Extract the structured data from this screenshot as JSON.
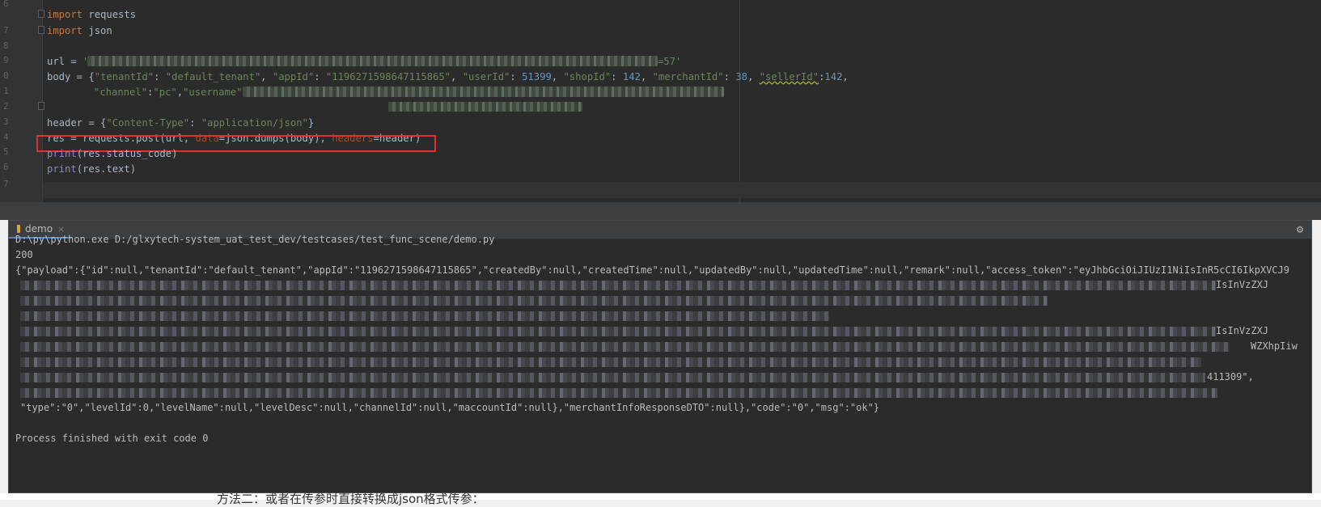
{
  "editor": {
    "line_numbers": [
      "6",
      "7",
      "8",
      "9",
      "0",
      "1",
      "2",
      "3",
      "4",
      "5",
      "6",
      "7"
    ],
    "lines": {
      "l6": {
        "kw": "import",
        "rest": " requests"
      },
      "l7": {
        "kw": "import",
        "rest": " json"
      },
      "l9": {
        "prefix": "url = ",
        "quote_open": "'",
        "visible_tail": "=57'"
      },
      "l10": {
        "a": "body = {",
        "k1": "\"tenantId\"",
        "s1": ": ",
        "v1": "\"default_tenant\"",
        "c1": ", ",
        "k2": "\"appId\"",
        "s2": ": ",
        "v2": "\"1196271598647115865\"",
        "c2": ", ",
        "k3": "\"userId\"",
        "s3": ": ",
        "v3": "51399",
        "c3": ", ",
        "k4": "\"shopId\"",
        "s4": ": ",
        "v4": "142",
        "c4": ", ",
        "k5": "\"merchantId\"",
        "s5": ": ",
        "v5": "38",
        "c5": ", ",
        "k6": "\"sellerId\"",
        "s6": ":",
        "v6": "142",
        "c6": ","
      },
      "l11": {
        "k1": "\"channel\"",
        "s1": ":",
        "v1": "\"pc\"",
        "c1": ",",
        "k2": "\"username\""
      },
      "l13": {
        "a": "header = {",
        "k": "\"Content-Type\"",
        "s": ": ",
        "v": "\"application/json\"",
        "b": "}"
      },
      "l14": {
        "a": "res = requests.post(url, ",
        "p1": "data",
        "b": "=json.dumps(body), ",
        "p2": "headers",
        "c": "=header)"
      },
      "l15": {
        "fn": "print",
        "rest": "(res.status_code)"
      },
      "l16": {
        "fn": "print",
        "rest": "(res.text)"
      }
    }
  },
  "run_panel": {
    "tab_label": "demo",
    "tab_close": "×",
    "gear": "⚙",
    "command": "D:\\py\\python.exe D:/glxytech-system_uat_test_dev/testcases/test_func_scene/demo.py",
    "status_code": "200",
    "payload_start": "{\"payload\":{\"id\":null,\"tenantId\":\"default_tenant\",\"appId\":\"1196271598647115865\",\"createdBy\":null,\"createdTime\":null,\"updatedBy\":null,\"updatedTime\":null,\"remark\":null,\"access_token\":\"eyJhbGciOiJIUzI1NiIsInR5cCI6IkpXVCJ9",
    "tail_1": "IsInVzZXJ",
    "tail_2": "IsInVzZXJ",
    "tail_3": "WZXhpIiw",
    "tail_4": "411309\",",
    "payload_end": "\"type\":\"0\",\"levelId\":0,\"levelName\":null,\"levelDesc\":null,\"channelId\":null,\"maccountId\":null},\"merchantInfoResponseDTO\":null},\"code\":\"0\",\"msg\":\"ok\"}",
    "finished": "Process finished with exit code 0"
  },
  "background_text": "方法二：或者在传参时直接转换成json格式传参："
}
